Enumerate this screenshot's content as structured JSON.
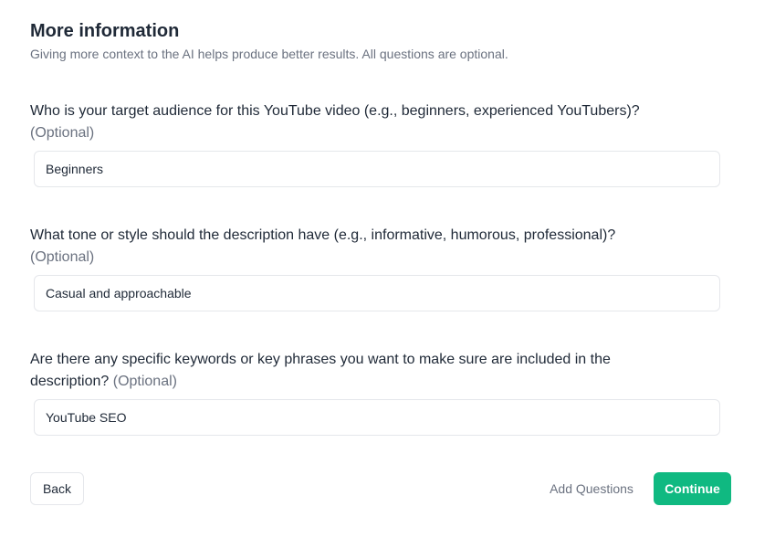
{
  "header": {
    "title": "More information",
    "subtitle": "Giving more context to the AI helps produce better results. All questions are optional."
  },
  "questions": [
    {
      "text": "Who is your target audience for this YouTube video (e.g., beginners, experienced YouTubers)?",
      "optional": "(Optional)",
      "value": "Beginners"
    },
    {
      "text": "What tone or style should the description have (e.g., informative, humorous, professional)?",
      "optional": "(Optional)",
      "value": "Casual and approachable"
    },
    {
      "text": "Are there any specific keywords or key phrases you want to make sure are included in the description?",
      "optional": "(Optional)",
      "value": "YouTube SEO"
    }
  ],
  "footer": {
    "back_label": "Back",
    "add_questions_label": "Add Questions",
    "continue_label": "Continue"
  },
  "colors": {
    "accent": "#10b981",
    "muted_text": "#6b7280",
    "border": "#e5e7eb"
  }
}
